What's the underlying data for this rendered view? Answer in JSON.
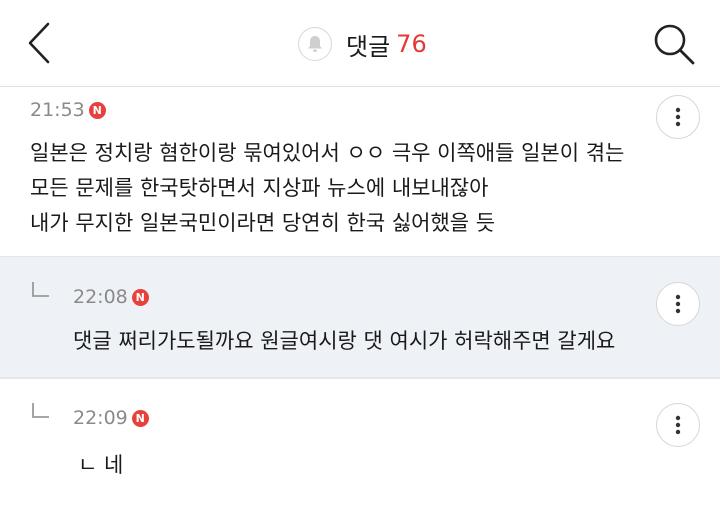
{
  "header": {
    "back_icon": "chevron-left-icon",
    "bell_icon": "bell-icon",
    "title": "댓글",
    "count": "76",
    "search_icon": "search-icon",
    "accent_color": "#e53935"
  },
  "comments": [
    {
      "time": "21:53",
      "badge": "N",
      "is_reply": false,
      "lines": [
        "일본은 정치랑 혐한이랑 묶여있어서 ㅇㅇ 극우 이쪽애들 일본이 겪는",
        "모든 문제를 한국탓하면서 지상파 뉴스에 내보내잖아",
        "내가 무지한 일본국민이라면 당연히 한국 싫어했을 듯"
      ]
    },
    {
      "time": "22:08",
      "badge": "N",
      "is_reply": true,
      "lines": [
        "댓글 쩌리가도될까요 원글여시랑 댓 여시가 허락해주면 갈게요"
      ]
    },
    {
      "time": "22:09",
      "badge": "N",
      "is_reply": true,
      "lines": [
        "ㄴ 네"
      ]
    }
  ]
}
